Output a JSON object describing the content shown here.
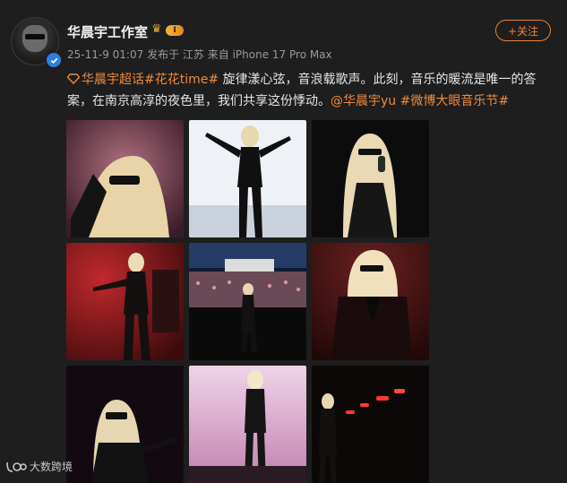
{
  "post": {
    "author": "华晨宇工作室",
    "level": "I",
    "timestamp": "25-11-9 01:07",
    "posted_from_label": "发布于",
    "location": "江苏",
    "source_label": "来自",
    "device": "iPhone 17 Pro Max",
    "follow_label": "+关注",
    "text": {
      "tag1": "华晨宇超话",
      "tag2": "#花花time#",
      "body1": " 旋律漾心弦，音浪载歌声。此刻，音乐的暖流是唯一的答案，在南京高淳的夜色里，我们共享这份悸动。",
      "mention": "@华晨宇yu",
      "tag3": " #微博大眼音乐节#"
    }
  },
  "photos": [
    {
      "id": "photo-1",
      "theme": "pink"
    },
    {
      "id": "photo-2",
      "theme": "white"
    },
    {
      "id": "photo-3",
      "theme": "dark"
    },
    {
      "id": "photo-4",
      "theme": "red"
    },
    {
      "id": "photo-5",
      "theme": "crowd"
    },
    {
      "id": "photo-6",
      "theme": "dark-red"
    },
    {
      "id": "photo-7",
      "theme": "dark"
    },
    {
      "id": "photo-8",
      "theme": "pink-light"
    },
    {
      "id": "photo-9",
      "theme": "red-lights"
    }
  ],
  "watermark": {
    "text": "大数跨境",
    "icon": "logo-icon"
  },
  "colors": {
    "accent": "#f08a3c",
    "background": "#1e1e1e",
    "verified": "#2d7fe0"
  }
}
